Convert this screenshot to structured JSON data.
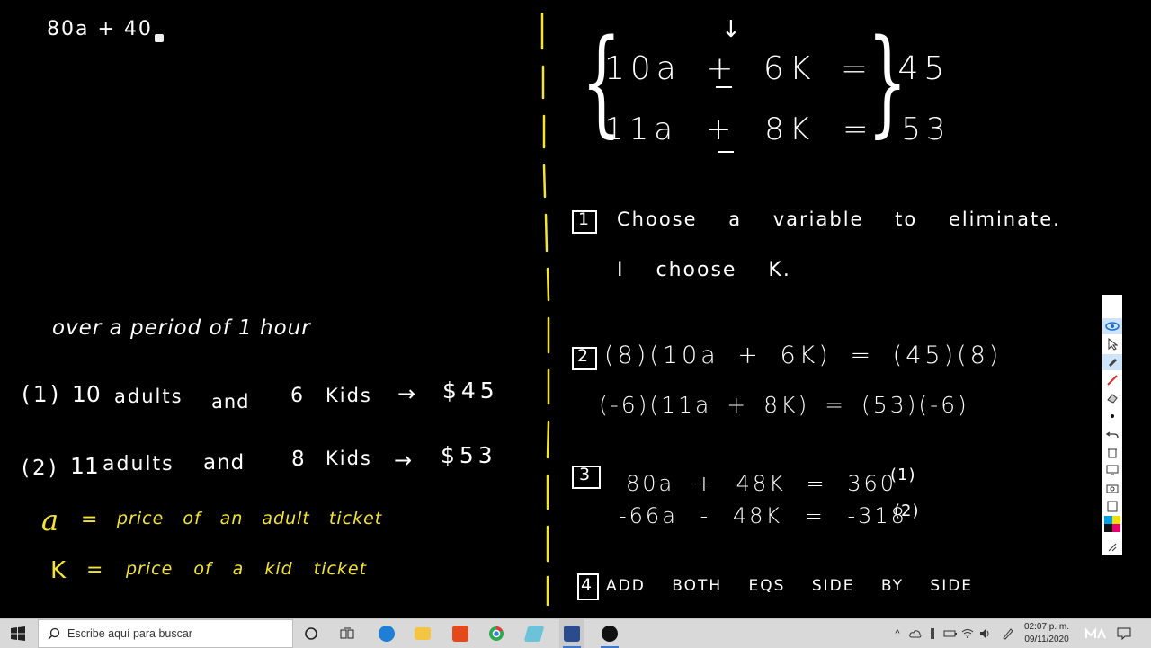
{
  "board": {
    "left": {
      "top_expr": "80a + 40",
      "heading": "over a period of 1 hour",
      "lines": [
        {
          "num": "(1)",
          "count": "10",
          "who": "adults",
          "and": "and",
          "kcount": "6",
          "kids": "Kids",
          "arrow": "→",
          "price": "$45"
        },
        {
          "num": "(2)",
          "count": "11",
          "who": "adults",
          "and": "and",
          "kcount": "8",
          "kids": "Kids",
          "arrow": "→",
          "price": "$53"
        }
      ],
      "defs": [
        {
          "var": "a",
          "eq": "=",
          "text": "price of an adult ticket"
        },
        {
          "var": "K",
          "eq": "=",
          "text": "price of a kid ticket"
        }
      ]
    },
    "right": {
      "system": [
        "10a + 6K = 45",
        "11a + 8K = 53"
      ],
      "step1": {
        "num": "1",
        "text": "Choose a variable to eliminate.",
        "sub": "I choose K."
      },
      "step2": {
        "num": "2",
        "line1": "(8)(10a + 6K) = (45)(8)",
        "line2": "(-6)(11a + 8K) = (53)(-6)"
      },
      "step3": {
        "num": "3",
        "line1": "80a + 48K = 360",
        "tag1": "(1)",
        "line2": "-66a - 48K = -318",
        "tag2": "(2)"
      },
      "step4": {
        "num": "4",
        "text": "ADD BOTH EQS SIDE BY SIDE"
      }
    }
  },
  "toolbar": {
    "items": [
      "pen-icon",
      "eye-icon",
      "cursor-icon",
      "highlighter-icon",
      "line-icon",
      "eraser-icon",
      "dot-icon",
      "undo-icon",
      "trash-icon",
      "screen-icon",
      "camera-icon",
      "clipboard-icon",
      "palette-icon",
      "resize-icon"
    ]
  },
  "taskbar": {
    "search_placeholder": "Escribe aquí para buscar",
    "time": "02:07 p. m.",
    "date": "09/11/2020",
    "colors": {
      "edge": "#1f7fd6",
      "explorer": "#f4c542",
      "office": "#e2491d",
      "chrome": "#2da94f",
      "accent": "#3a78d8"
    }
  }
}
